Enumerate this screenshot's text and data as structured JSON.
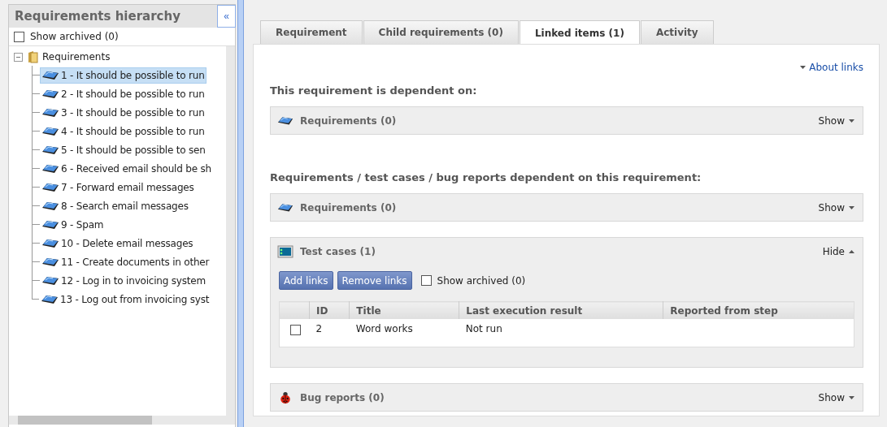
{
  "sidebar": {
    "title": "Requirements hierarchy",
    "collapse_button": "«",
    "show_archived": {
      "label": "Show archived (0)",
      "checked": false
    },
    "tree": {
      "label": "Requirements",
      "expanded": true,
      "children": [
        {
          "label": "1 - It should be possible to run",
          "selected": true
        },
        {
          "label": "2 - It should be possible to run",
          "selected": false
        },
        {
          "label": "3 - It should be possible to run",
          "selected": false
        },
        {
          "label": "4 - It should be possible to run",
          "selected": false
        },
        {
          "label": "5 - It should be possible to sen",
          "selected": false
        },
        {
          "label": "6 - Received email should be sh",
          "selected": false
        },
        {
          "label": "7 - Forward email messages",
          "selected": false
        },
        {
          "label": "8 - Search email messages",
          "selected": false
        },
        {
          "label": "9 - Spam",
          "selected": false
        },
        {
          "label": "10 - Delete email messages",
          "selected": false
        },
        {
          "label": "11 - Create documents in other",
          "selected": false
        },
        {
          "label": "12 - Log in to invoicing system",
          "selected": false
        },
        {
          "label": "13 - Log out from invoicing syst",
          "selected": false
        }
      ]
    }
  },
  "tabs": [
    {
      "label": "Requirement",
      "selected": false
    },
    {
      "label": "Child requirements (0)",
      "selected": false
    },
    {
      "label": "Linked items (1)",
      "selected": true
    },
    {
      "label": "Activity",
      "selected": false
    }
  ],
  "about_link": "About links",
  "groups": [
    {
      "heading": "This requirement is dependent on:",
      "panels": [
        {
          "kind": "requirement",
          "title": "Requirements (0)",
          "toggle": "Show",
          "expanded": false
        }
      ]
    },
    {
      "heading": "Requirements / test cases / bug reports dependent on this requirement:",
      "panels": [
        {
          "kind": "requirement",
          "title": "Requirements (0)",
          "toggle": "Show",
          "expanded": false
        },
        {
          "kind": "testcase",
          "title": "Test cases (1)",
          "toggle": "Hide",
          "expanded": true,
          "buttons": [
            "Add links",
            "Remove links"
          ],
          "show_archived": {
            "label": "Show archived (0)",
            "checked": false
          },
          "table": {
            "columns": [
              "ID",
              "Title",
              "Last execution result",
              "Reported from step"
            ],
            "rows": [
              {
                "checked": false,
                "cells": [
                  "2",
                  "Word works",
                  "Not run",
                  ""
                ]
              }
            ]
          }
        },
        {
          "kind": "bug",
          "title": "Bug reports (0)",
          "toggle": "Show",
          "expanded": false
        }
      ]
    }
  ]
}
